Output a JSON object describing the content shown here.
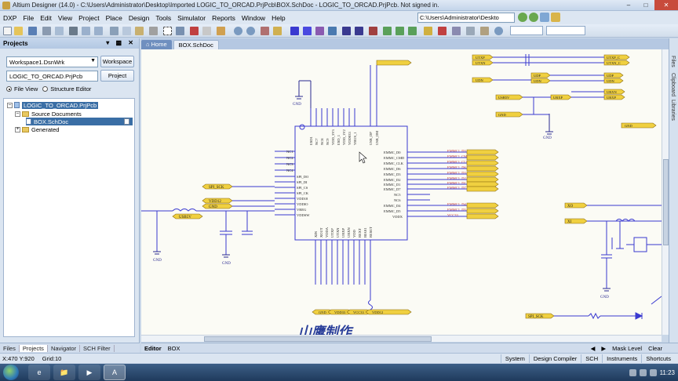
{
  "window": {
    "title": "Altium Designer (14.0) - C:\\Users\\Administrator\\Desktop\\Imported LOGIC_TO_ORCAD.PrjPcb\\BOX.SchDoc - LOGIC_TO_ORCAD.PrjPcb. Not signed in.",
    "path": "C:\\Users\\Administrator\\Deskto"
  },
  "menu": {
    "items": [
      "DXP",
      "File",
      "Edit",
      "View",
      "Project",
      "Place",
      "Design",
      "Tools",
      "Simulator",
      "Reports",
      "Window",
      "Help"
    ]
  },
  "projects_panel": {
    "title": "Projects",
    "workspace_value": "Workspace1.DsnWrk",
    "workspace_button": "Workspace",
    "project_value": "LOGIC_TO_ORCAD.PrjPcb",
    "project_button": "Project",
    "file_view": "File View",
    "structure_editor": "Structure Editor",
    "tree": {
      "project": "LOGIC_TO_ORCAD.PrjPcb",
      "source_documents": "Source Documents",
      "document": "BOX.SchDoc",
      "generated": "Generated"
    },
    "tabs": [
      "Files",
      "Projects",
      "Navigator",
      "SCH Filter"
    ]
  },
  "document_tabs": {
    "home": "Home",
    "box": "BOX.SchDoc"
  },
  "right_strip": [
    "Files",
    "Clipboard",
    "Libraries"
  ],
  "schematic": {
    "gnd": "GND",
    "left_pins": [
      "NC1",
      "NC2",
      "NC3",
      "NC4",
      "SPI_DO",
      "SPI_DI",
      "SPI_CS",
      "SPI_CK",
      "VDD18",
      "VDDIO",
      "VREG",
      "VDDSW"
    ],
    "right_pins": [
      "EMMC_D0",
      "EMMC_CMD",
      "EMMC_CLK",
      "EMMC_D6",
      "EMMC_D3",
      "EMMC_D2",
      "EMMC_D1",
      "EMMC_D7",
      "NC5",
      "NC6",
      "EMMC_D4",
      "EMMC_D5",
      "VDDX"
    ],
    "top_pins": [
      "ESD1",
      "NC7",
      "NC8",
      "NC9",
      "VDD_3V3",
      "ESD_1",
      "VDD_1V2",
      "VDDS33",
      "VBUS_1",
      "USB_DP",
      "USB_DM"
    ],
    "bottom_pins": [
      "XIN",
      "XOUT",
      "VDDA",
      "UTXP",
      "UTXN",
      "URXP",
      "URXN",
      "VDD",
      "REXT",
      "BIAS1",
      "RESET"
    ],
    "emmc_labels": [
      "EMMC1_D3",
      "EMMC1_CMD",
      "EMMC1_CLK",
      "EMMC1_D6",
      "EMMC1_D3",
      "EMMC1_D2",
      "EMMC1_D1",
      "EMMC1_D7",
      "EMMC1_D4",
      "EMMC1_D5",
      "VCC33"
    ],
    "ports_left": [
      "SPI_SCK",
      "VDD12",
      "GND",
      "USB5V"
    ],
    "ports_top_right": [
      "UTXP",
      "UTXN",
      "URXN",
      "UDP",
      "UDN",
      "USB5V",
      "URXP",
      "GND"
    ],
    "ports_right": [
      "UTXP_C",
      "UTXN_C",
      "UDP",
      "UDN",
      "URXN",
      "URXP",
      "GND"
    ],
    "bottom_ports": [
      "GND",
      "VDD33",
      "VCC33",
      "VDD12"
    ],
    "xo": "XO",
    "xi": "XI",
    "spi_sck_port": "SPI_SCK",
    "watermark": "山鹰制作"
  },
  "editor_tabs": {
    "editor": "Editor",
    "box": "BOX"
  },
  "mask": {
    "label": "Mask Level",
    "clear": "Clear"
  },
  "status": {
    "coords": "X:470 Y:920",
    "grid": "Grid:10",
    "buttons": [
      "System",
      "Design Compiler",
      "SCH",
      "Instruments",
      "Shortcuts"
    ]
  },
  "taskbar": {
    "apps": [
      "IE",
      "Folder",
      "Media",
      "Altium"
    ],
    "time": "11:23"
  },
  "colors": {
    "wire": "#3a3ad0",
    "port_fill": "#f0d040",
    "port_border": "#8a6a10",
    "gnd": "#2a2a90"
  }
}
